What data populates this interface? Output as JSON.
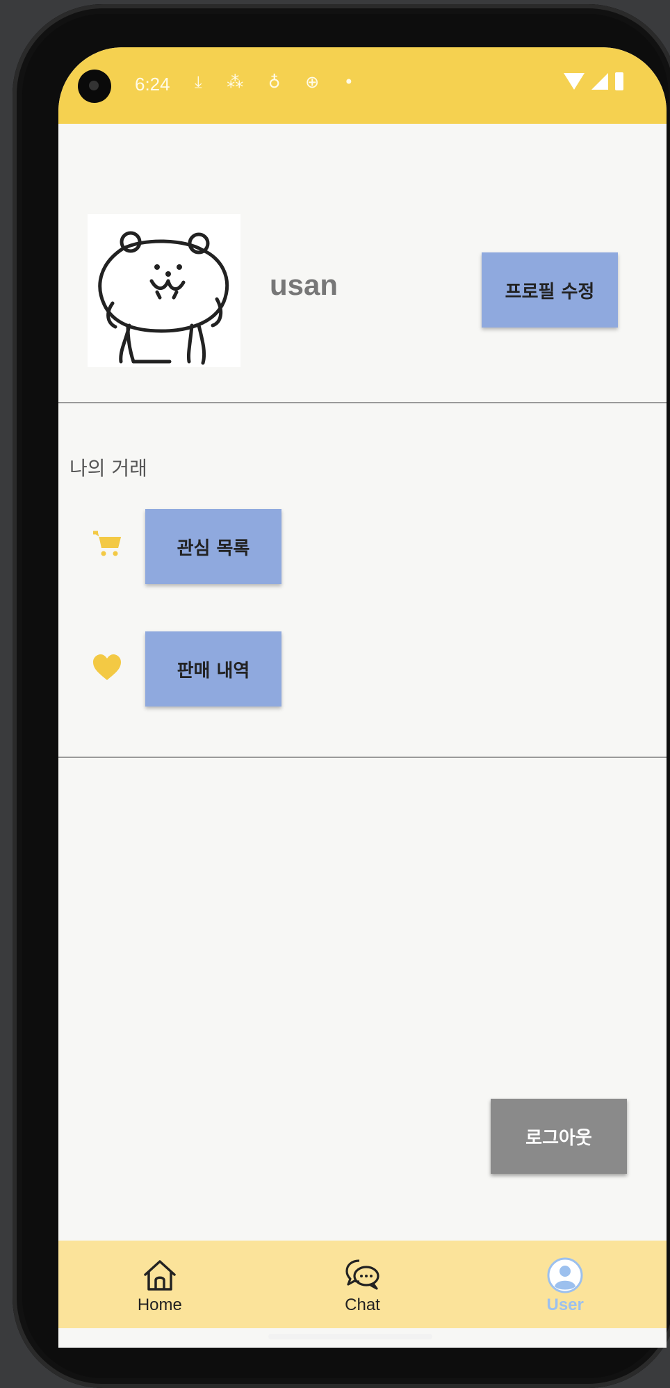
{
  "status_bar": {
    "time": "6:24",
    "notification_icons": "⤓ ⁂ ♁ ⊕ •"
  },
  "profile": {
    "username": "usan",
    "edit_button_label": "프로필 수정"
  },
  "my_trades": {
    "section_title": "나의 거래",
    "wishlist_label": "관심 목록",
    "sales_history_label": "판매 내역"
  },
  "logout_label": "로그아웃",
  "bottom_nav": {
    "home_label": "Home",
    "chat_label": "Chat",
    "user_label": "User"
  },
  "colors": {
    "status_bar": "#f5d150",
    "button_blue": "#8fa9de",
    "logout_gray": "#8a8a8a",
    "nav_bg": "#fbe39a",
    "icon_yellow": "#f3c944",
    "active_nav": "#9cc0ee"
  },
  "icons": {
    "wishlist": "cart-icon",
    "sales": "heart-icon",
    "nav_home": "home-icon",
    "nav_chat": "chat-icon",
    "nav_user": "user-icon"
  }
}
